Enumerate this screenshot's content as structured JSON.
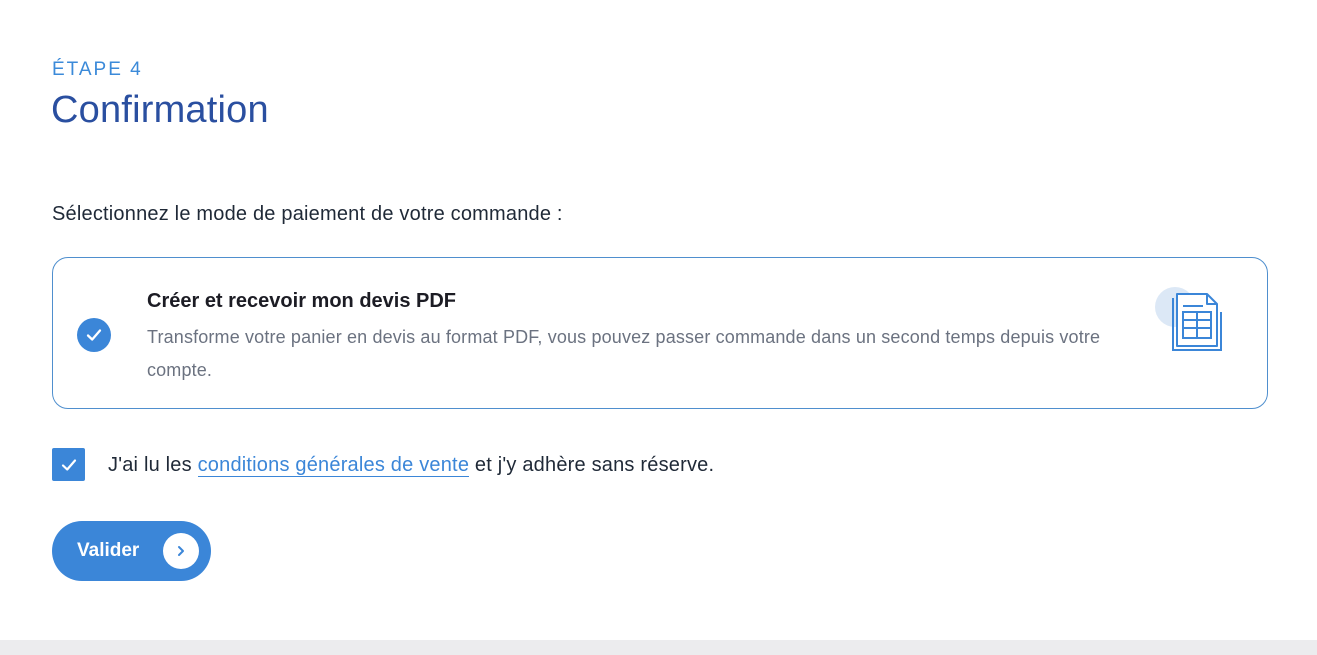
{
  "step": {
    "kicker": "ÉTAPE 4",
    "title": "Confirmation"
  },
  "payment": {
    "instruction": "Sélectionnez le mode de paiement de votre commande :",
    "option": {
      "title": "Créer et recevoir mon devis PDF",
      "description": "Transforme votre panier en devis au format PDF, vous pouvez passer commande dans un second temps depuis votre compte.",
      "selected": true,
      "icon": "document-table-icon"
    }
  },
  "terms": {
    "checked": true,
    "prefix": "J'ai lu les ",
    "link_label": "conditions générales de vente",
    "suffix": " et j'y adhère sans réserve."
  },
  "actions": {
    "validate_label": "Valider",
    "validate_icon": "chevron-right-icon"
  },
  "colors": {
    "accent": "#3b86d8",
    "title": "#2a4fa0",
    "card_border": "#4f8fce",
    "footer": "#ececee"
  }
}
